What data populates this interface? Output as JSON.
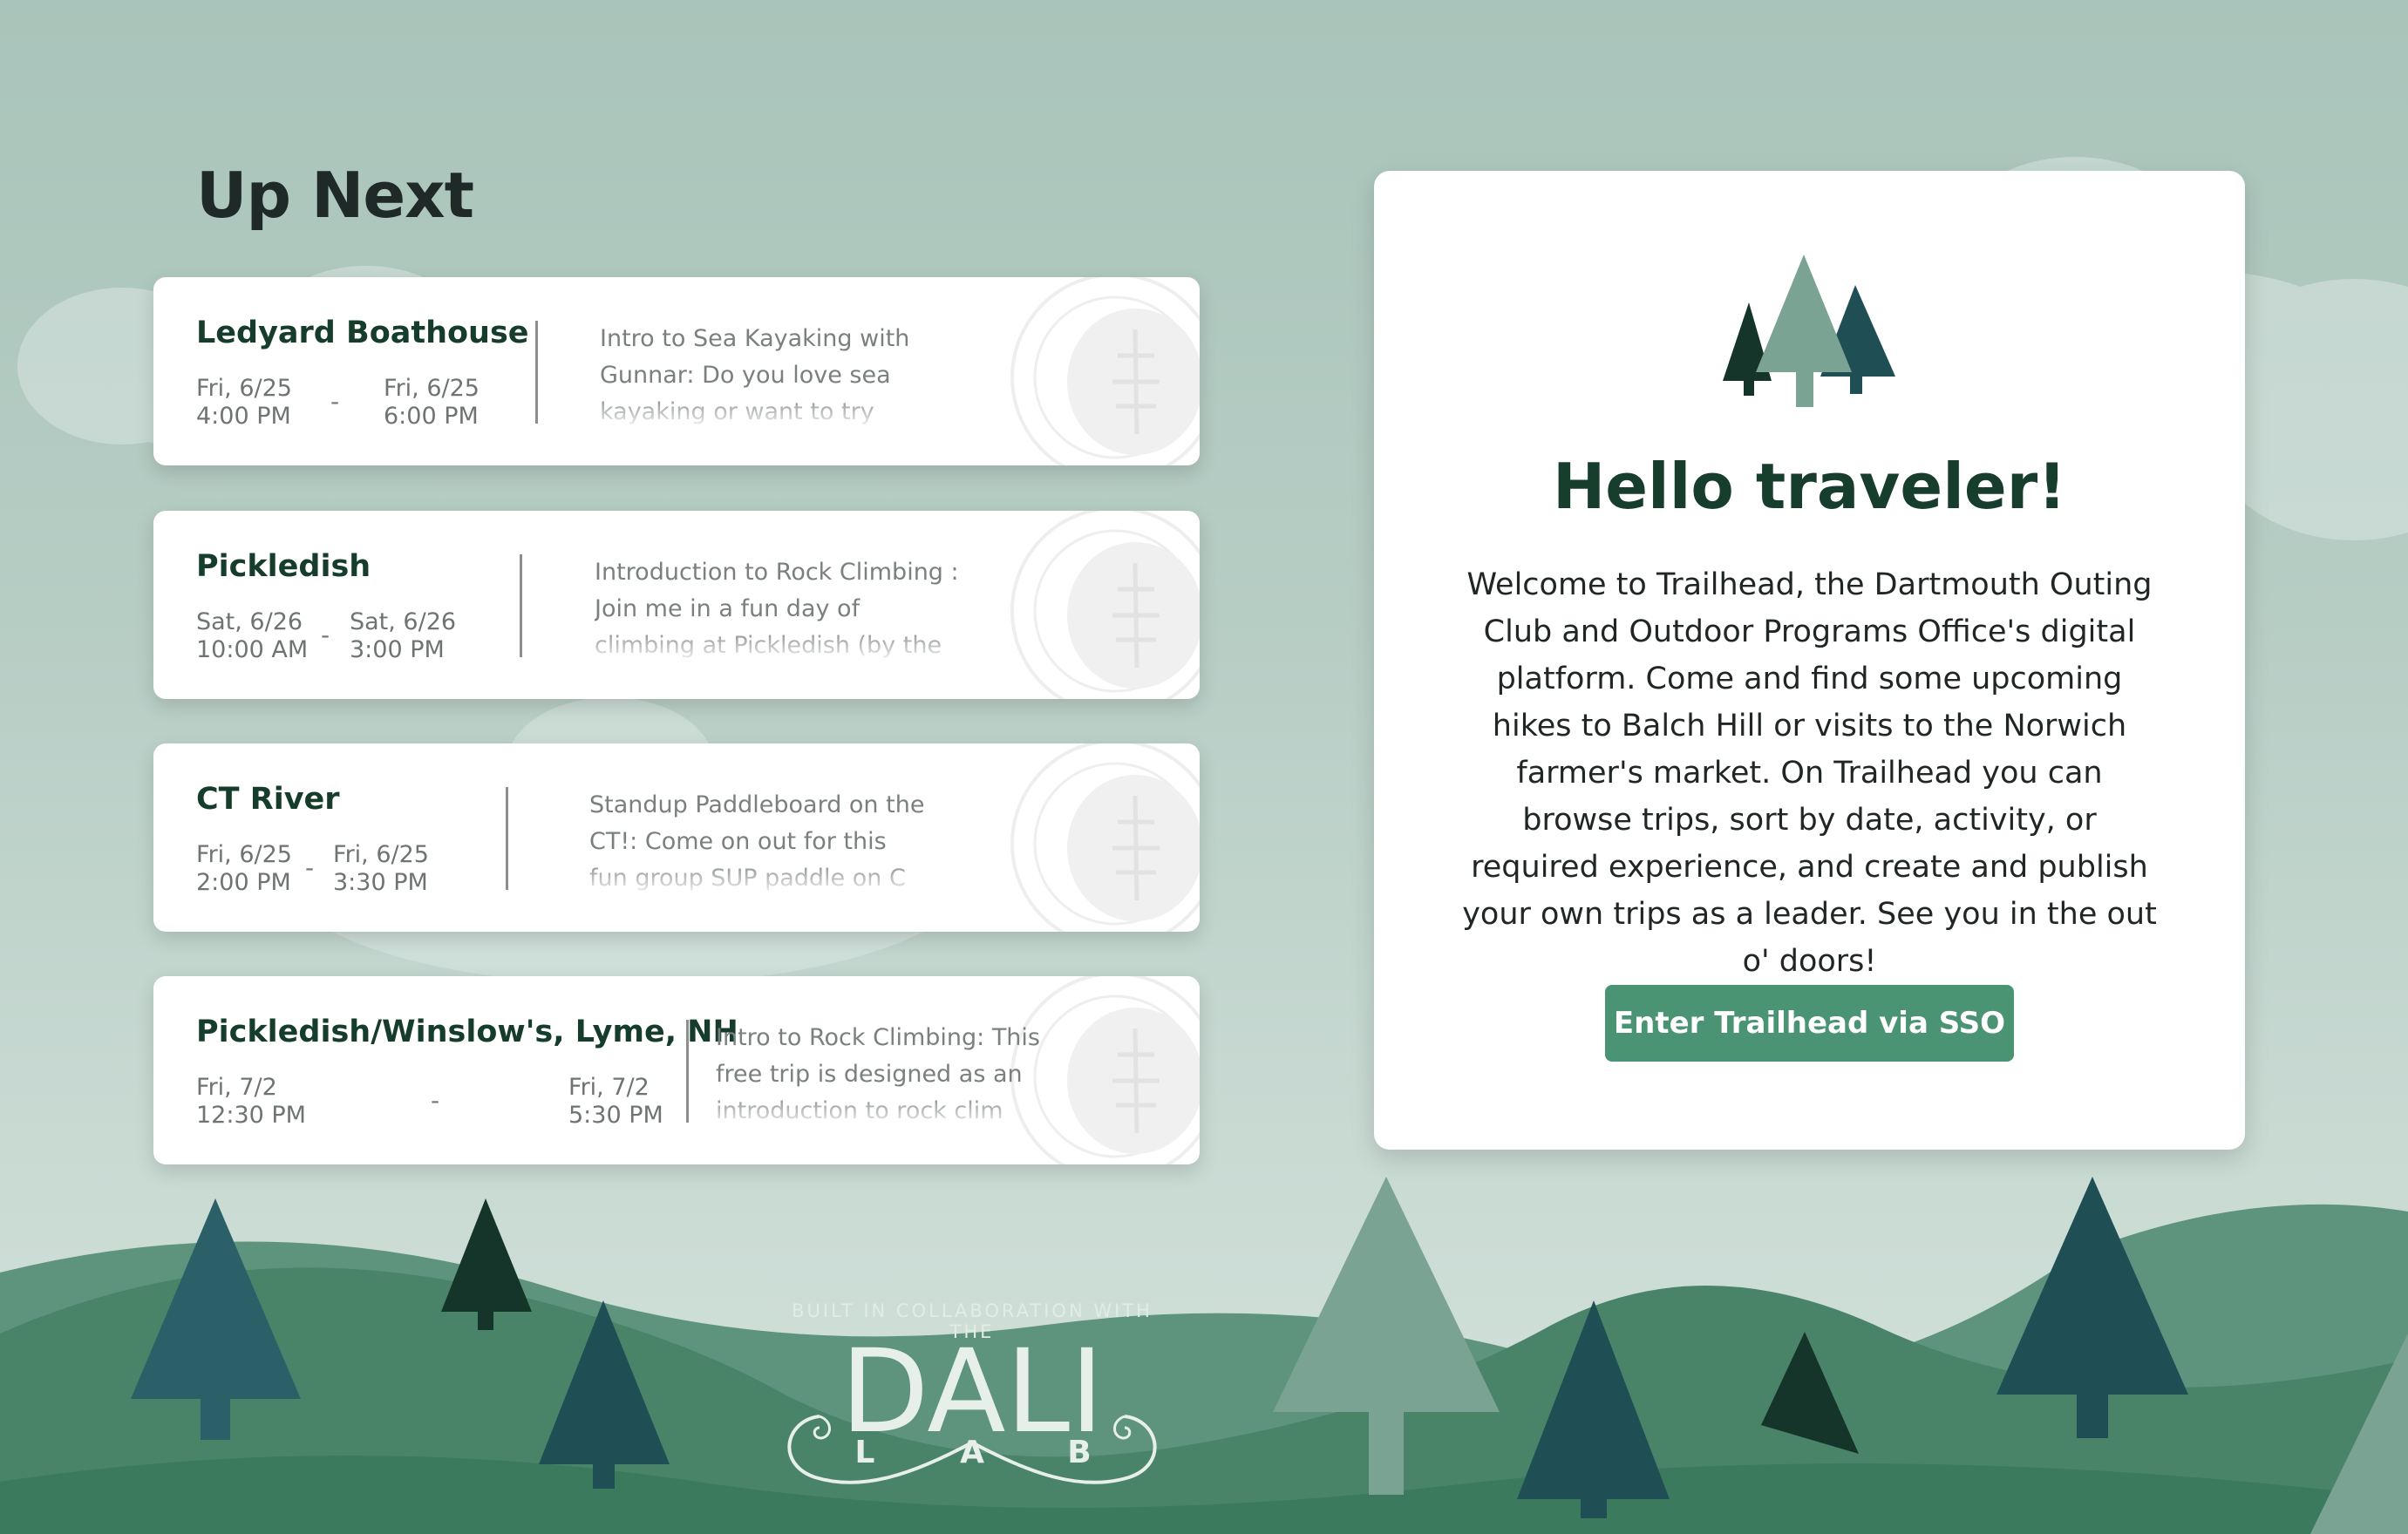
{
  "up_next": {
    "title": "Up Next",
    "trips": [
      {
        "location": "Ledyard Boathouse",
        "start_date": "Fri, 6/25",
        "start_time": "4:00 PM",
        "end_date": "Fri, 6/25",
        "end_time": "6:00 PM",
        "separator": "-",
        "description": "Intro to Sea Kayaking with Gunnar: Do you love sea kayaking or want to try"
      },
      {
        "location": "Pickledish",
        "start_date": "Sat, 6/26",
        "start_time": "10:00 AM",
        "end_date": "Sat, 6/26",
        "end_time": "3:00 PM",
        "separator": "-",
        "description": "Introduction to Rock Climbing : Join me in a fun day of climbing at Pickledish (by the Ski"
      },
      {
        "location": "CT River",
        "start_date": "Fri, 6/25",
        "start_time": "2:00 PM",
        "end_date": "Fri, 6/25",
        "end_time": "3:30 PM",
        "separator": "-",
        "description": "Standup Paddleboard on the CT!: Come on out for this fun group SUP paddle on C"
      },
      {
        "location": "Pickledish/Winslow's, Lyme, NH",
        "start_date": "Fri, 7/2",
        "start_time": "12:30 PM",
        "end_date": "Fri, 7/2",
        "end_time": "5:30 PM",
        "separator": "-",
        "description": "Intro to Rock Climbing: This free trip is designed as an introduction to rock clim"
      }
    ]
  },
  "welcome": {
    "title": "Hello traveler!",
    "body": "Welcome to Trailhead, the Dartmouth Outing Club and Outdoor Programs Office's digital platform. Come and find some upcoming hikes to Balch Hill or visits to the Norwich farmer's market. On Trailhead you can browse trips, sort by date, activity, or required experience, and create and publish your own trips as a leader. See you in the out o' doors!",
    "button_label": "Enter Trailhead via SSO",
    "icon": "trees-icon"
  },
  "footer": {
    "tagline": "BUILT IN COLLABORATION WITH THE",
    "logo_word": "DALI",
    "logo_letters": [
      "L",
      "A",
      "B"
    ]
  },
  "colors": {
    "sky": "#a9c4ba",
    "hill_dark": "#3f8064",
    "tree_teal": "#1f4f55",
    "tree_dark": "#16352a",
    "tree_sage": "#7ba393",
    "button": "#4a9474",
    "heading_green": "#173d2d"
  }
}
